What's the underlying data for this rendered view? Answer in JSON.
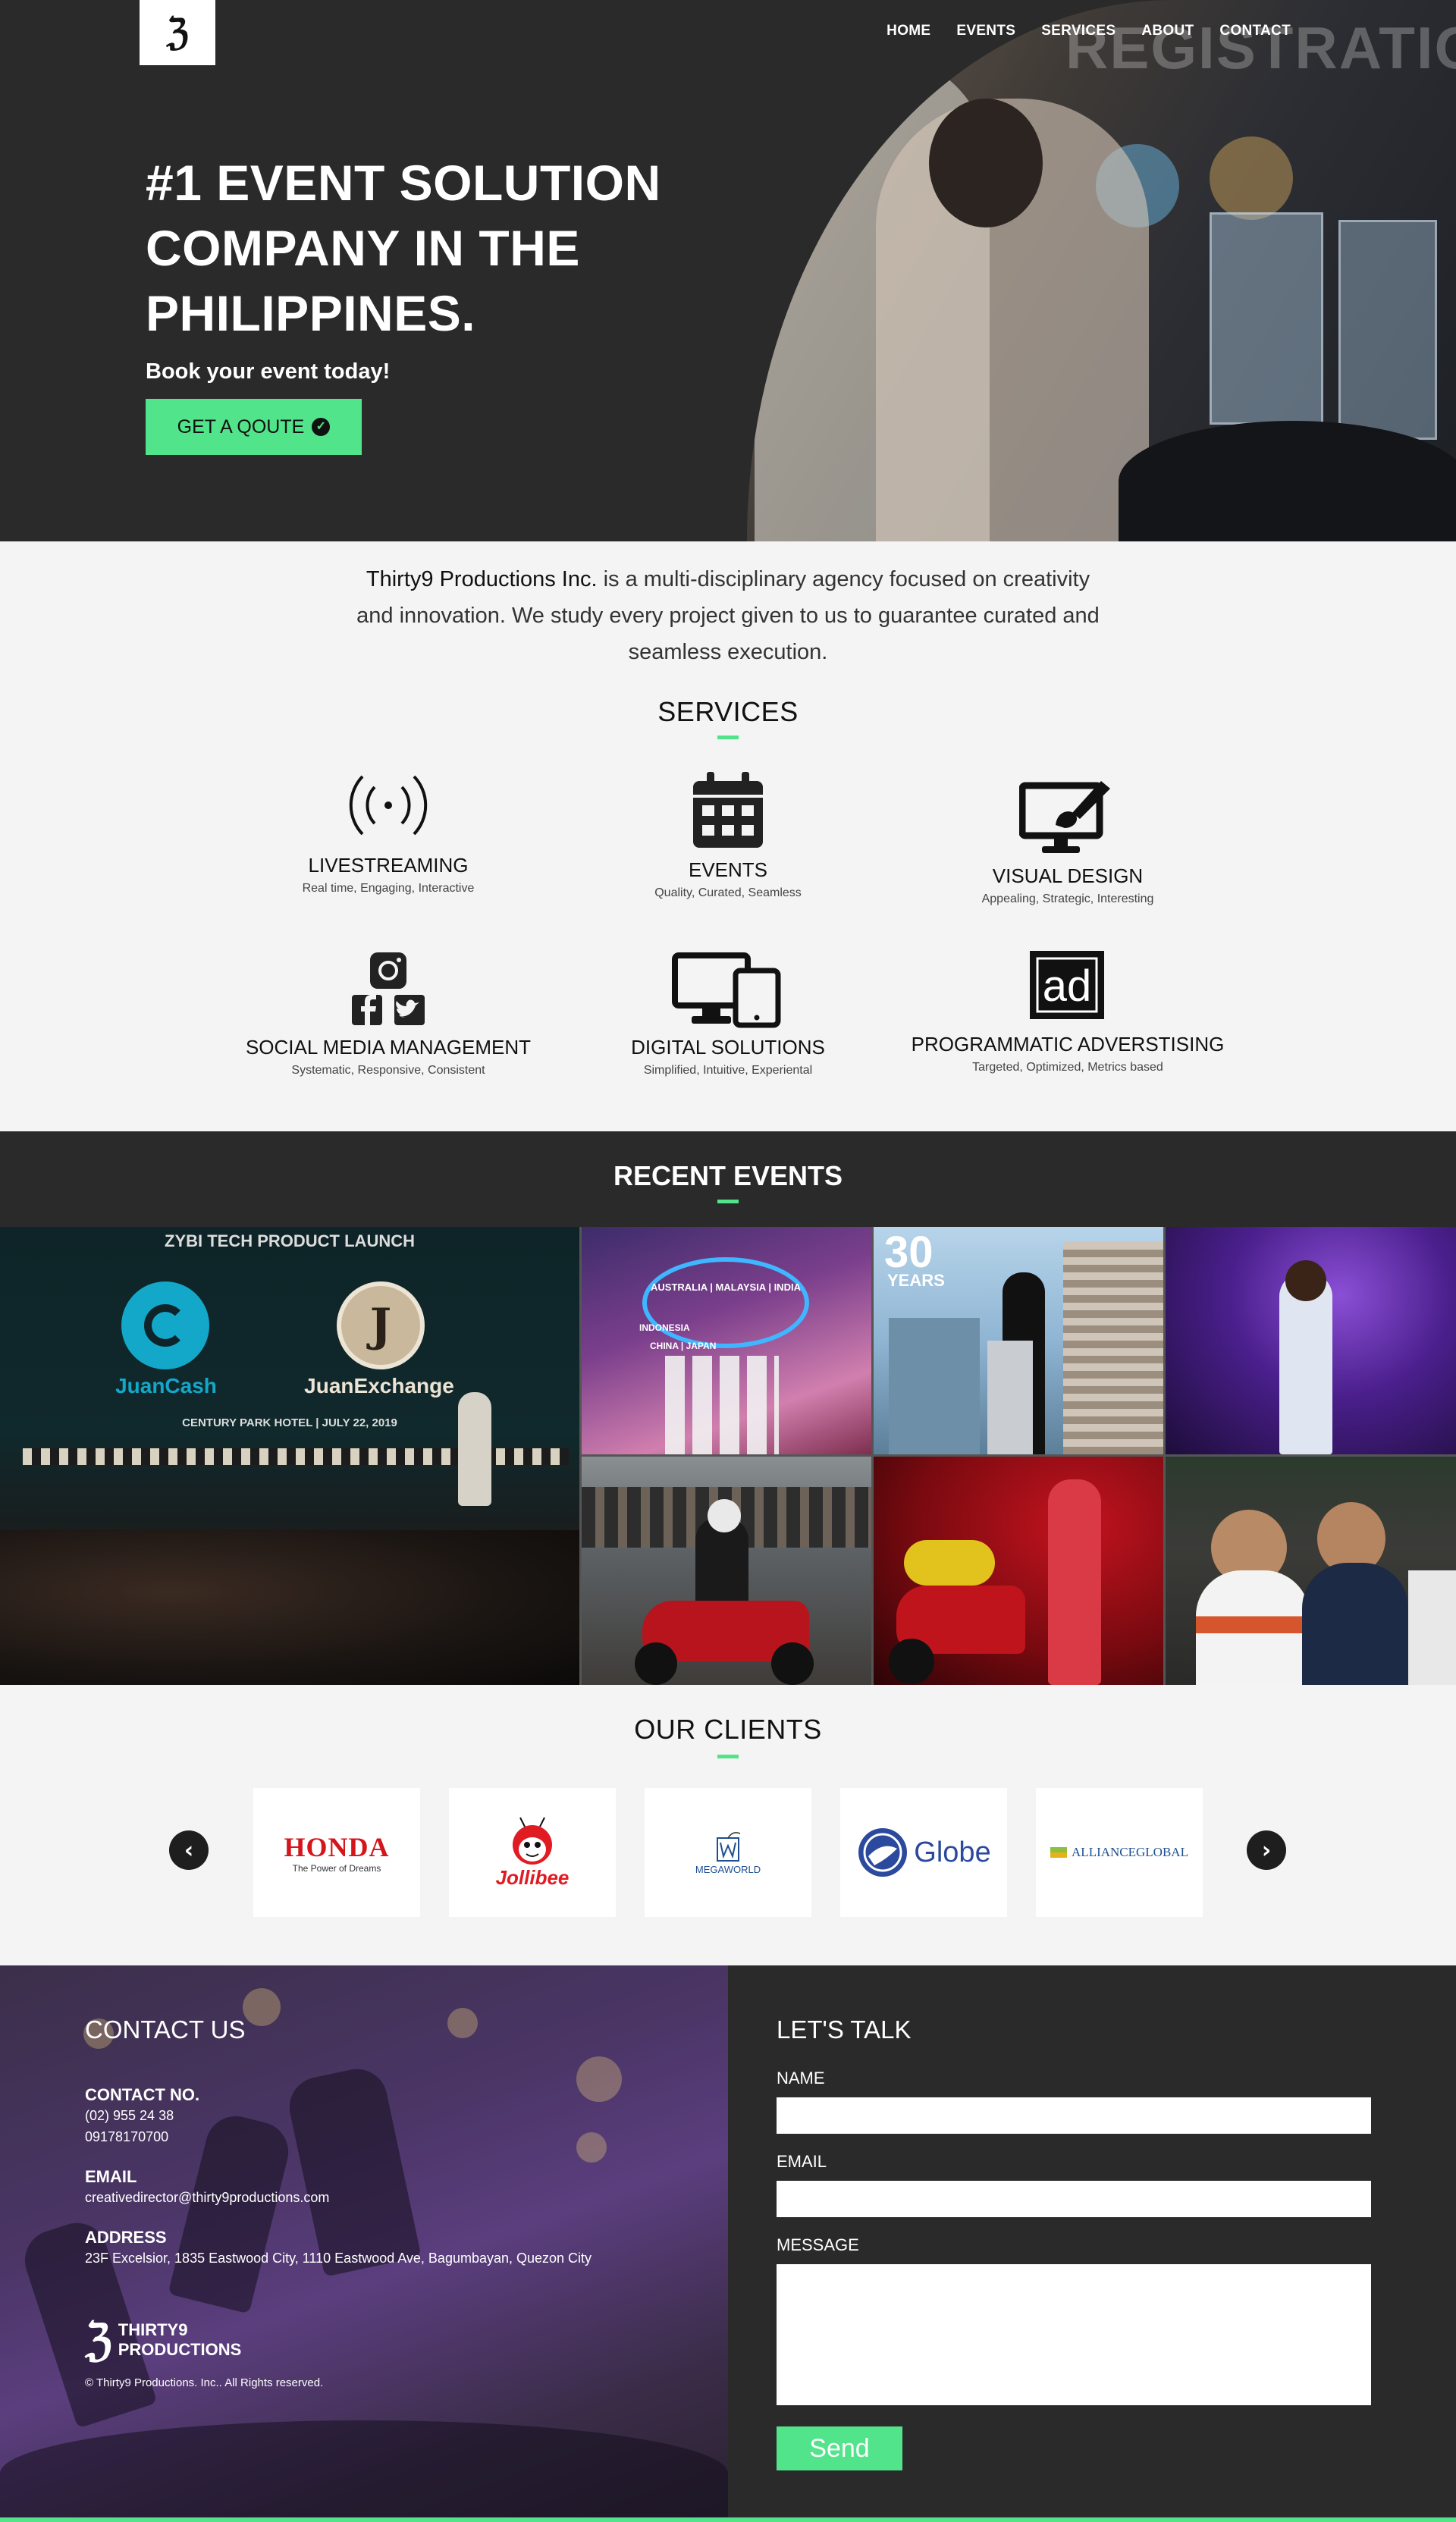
{
  "nav": {
    "items": [
      "HOME",
      "EVENTS",
      "SERVICES",
      "ABOUT",
      "CONTACT"
    ]
  },
  "hero": {
    "photo_sign": "REGISTRATION",
    "title": "#1 EVENT SOLUTION COMPANY IN THE PHILIPPINES.",
    "subtitle": "Book your event today!",
    "cta_label": "GET A QOUTE"
  },
  "intro": {
    "company": "Thirty9 Productions Inc.",
    "text": " is a multi-disciplinary agency focused on creativity and innovation. We study every project given to us to guarantee curated and seamless execution."
  },
  "services": {
    "title": "SERVICES",
    "items": [
      {
        "name": "LIVESTREAMING",
        "desc": "Real time, Engaging, Interactive",
        "icon": "broadcast-icon"
      },
      {
        "name": "EVENTS",
        "desc": "Quality, Curated, Seamless",
        "icon": "calendar-icon"
      },
      {
        "name": "VISUAL DESIGN",
        "desc": "Appealing, Strategic, Interesting",
        "icon": "design-monitor-icon"
      },
      {
        "name": "SOCIAL MEDIA MANAGEMENT",
        "desc": "Systematic, Responsive, Consistent",
        "icon": "social-media-icon"
      },
      {
        "name": "DIGITAL SOLUTIONS",
        "desc": "Simplified, Intuitive, Experiental",
        "icon": "devices-icon"
      },
      {
        "name": "PROGRAMMATIC ADVERSTISING",
        "desc": "Targeted, Optimized, Metrics based",
        "icon": "ad-icon"
      }
    ]
  },
  "recent_events": {
    "title": "RECENT EVENTS",
    "featured": {
      "caption": "ZYBI TECH PRODUCT LAUNCH",
      "brand1": "JuanCash",
      "brand2": "JuanExchange",
      "venue": "CENTURY PARK HOTEL | JULY 22, 2019"
    },
    "tile_texts": {
      "countries_top": "AUSTRALIA | MALAYSIA | INDIA",
      "countries_left": "INDONESIA",
      "countries_bottom": "CHINA | JAPAN",
      "anniversary_num": "30",
      "anniversary_word": "YEARS"
    }
  },
  "clients": {
    "title": "OUR CLIENTS",
    "logos": [
      {
        "name": "HONDA",
        "tagline": "The Power of Dreams"
      },
      {
        "name": "Jollibee"
      },
      {
        "name": "MEGAWORLD"
      },
      {
        "name": "Globe"
      },
      {
        "name": "ALLIANCEGLOBAL"
      }
    ]
  },
  "contact": {
    "heading": "CONTACT US",
    "phone_label": "CONTACT NO.",
    "phone1": "(02) 955 24 38",
    "phone2": "09178170700",
    "email_label": "EMAIL",
    "email": "creativedirector@thirty9productions.com",
    "address_label": "ADDRESS",
    "address": "23F Excelsior, 1835 Eastwood City, 1110 Eastwood Ave, Bagumbayan, Quezon City",
    "brand_line1": "THIRTY9",
    "brand_line2": "PRODUCTIONS",
    "copyright": "© Thirty9 Productions. Inc.. All Rights reserved."
  },
  "form": {
    "heading": "LET'S TALK",
    "name_label": "NAME",
    "email_label": "EMAIL",
    "message_label": "MESSAGE",
    "send_label": "Send"
  },
  "colors": {
    "accent": "#51e48a",
    "dark": "#2a2a2b",
    "light_bg": "#f4f4f4"
  }
}
